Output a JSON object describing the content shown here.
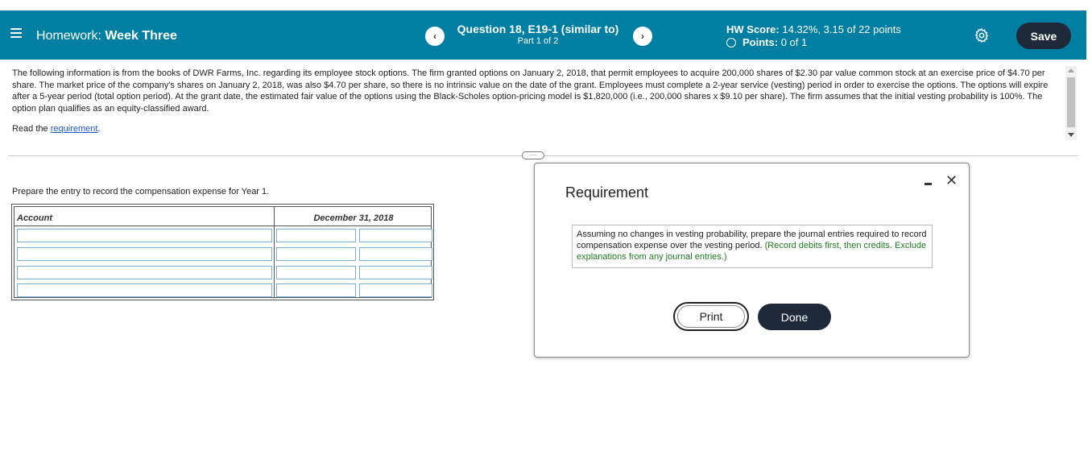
{
  "header": {
    "hw_prefix": "Homework:",
    "hw_name": "Week Three",
    "question_title": "Question 18, E19-1 (similar to)",
    "question_part": "Part 1 of 2",
    "hw_score_label": "HW Score:",
    "hw_score_value": "14.32%, 3.15 of 22 points",
    "points_label": "Points:",
    "points_value": "0 of 1",
    "save_label": "Save",
    "prev_label": "‹",
    "next_label": "›",
    "bg_color": "#007fa3"
  },
  "problem": {
    "intro": "The following information is from the books of DWR Farms, Inc. regarding its employee stock options. The firm granted options on January 2, 2018, that permit employees to acquire 200,000 shares of $2.30 par value common stock at an exercise price of $4.70 per share. The market price of the company's shares on January 2, 2018, was also $4.70 per share, so there is no intrinsic value on the date of the grant. Employees must complete a 2-year service (vesting) period in order to exercise the options. The options will expire after a 5-year period (total option period). At the grant date, the estimated fair value of the options using the Black-Scholes option-pricing model is $1,820,000 (i.e., 200,000 shares x $9.10 per share). The firm assumes that the initial vesting probability is 100%. The option plan qualifies as an equity-classified award.",
    "read_prefix": "Read the ",
    "read_link": "requirement",
    "read_suffix": ".",
    "expand_label": "....."
  },
  "entry": {
    "prompt": "Prepare the entry to record the compensation expense for Year 1.",
    "col_account": "Account",
    "col_date": "December 31, 2018",
    "rows": [
      {
        "account": "",
        "debit": "",
        "credit": ""
      },
      {
        "account": "",
        "debit": "",
        "credit": ""
      },
      {
        "account": "",
        "debit": "",
        "credit": ""
      },
      {
        "account": "",
        "debit": "",
        "credit": ""
      }
    ]
  },
  "modal": {
    "title": "Requirement",
    "text_main": "Assuming no changes in vesting probability, prepare the journal entries required to record compensation expense over the vesting period.",
    "text_hint": "(Record debits first, then credits. Exclude explanations from any journal entries.)",
    "minimize_label": "–",
    "close_label": "✕",
    "print_label": "Print",
    "done_label": "Done"
  }
}
